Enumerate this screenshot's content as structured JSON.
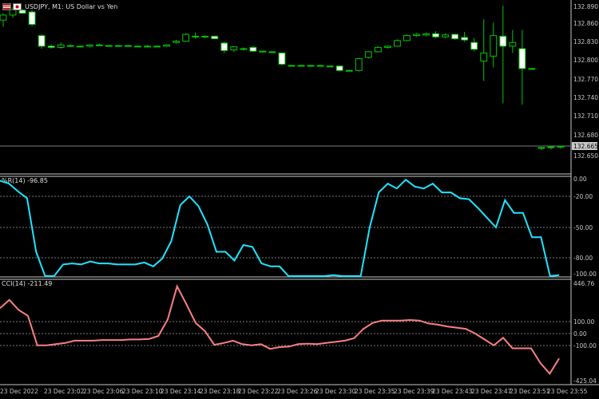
{
  "window": {
    "title": "USDJPY, M1:  US Dollar vs Yen"
  },
  "price_axis": {
    "labels": [
      "132.890",
      "132.860",
      "132.830",
      "132.800",
      "132.770",
      "132.740",
      "132.710",
      "132.680",
      "132.650"
    ],
    "current_price": "132.665"
  },
  "wpr": {
    "label": "%R(14) -96.85",
    "levels": [
      "0.00",
      "-20.00",
      "-50.00",
      "-80.00",
      "-100.00"
    ]
  },
  "cci": {
    "label": "CCI(14) -211.49",
    "levels": [
      "446.76",
      "100.00",
      "0.00",
      "-100.00",
      "-425.04"
    ]
  },
  "time_axis": {
    "labels": [
      "23 Dec 2022",
      "23 Dec 23:02",
      "23 Dec 23:06",
      "23 Dec 23:10",
      "23 Dec 23:14",
      "23 Dec 23:18",
      "23 Dec 23:22",
      "23 Dec 23:26",
      "23 Dec 23:30",
      "23 Dec 23:35",
      "23 Dec 23:39",
      "23 Dec 23:43",
      "23 Dec 23:47",
      "23 Dec 23:51",
      "23 Dec 23:55"
    ]
  },
  "colors": {
    "bull": "#00c800",
    "bear": "#ffffff",
    "wpr_line": "#1ee6ff",
    "cci_line": "#fa8080",
    "separator": "#c8c8c8",
    "grid": "#7a7a7a"
  },
  "chart_data": [
    {
      "type": "candlestick",
      "symbol": "USDJPY",
      "timeframe": "M1",
      "ylim": [
        132.64,
        132.9
      ],
      "candles": [
        {
          "o": 132.868,
          "h": 132.879,
          "l": 132.857,
          "c": 132.876
        },
        {
          "o": 132.876,
          "h": 132.889,
          "l": 132.872,
          "c": 132.885
        },
        {
          "o": 132.884,
          "h": 132.886,
          "l": 132.878,
          "c": 132.879
        },
        {
          "o": 132.881,
          "h": 132.884,
          "l": 132.858,
          "c": 132.861
        },
        {
          "o": 132.843,
          "h": 132.845,
          "l": 132.822,
          "c": 132.826
        },
        {
          "o": 132.826,
          "h": 132.829,
          "l": 132.822,
          "c": 132.824
        },
        {
          "o": 132.824,
          "h": 132.832,
          "l": 132.822,
          "c": 132.828
        },
        {
          "o": 132.827,
          "h": 132.829,
          "l": 132.825,
          "c": 132.826
        },
        {
          "o": 132.826,
          "h": 132.827,
          "l": 132.825,
          "c": 132.826
        },
        {
          "o": 132.826,
          "h": 132.829,
          "l": 132.824,
          "c": 132.828
        },
        {
          "o": 132.828,
          "h": 132.83,
          "l": 132.826,
          "c": 132.827
        },
        {
          "o": 132.827,
          "h": 132.828,
          "l": 132.826,
          "c": 132.827
        },
        {
          "o": 132.827,
          "h": 132.828,
          "l": 132.826,
          "c": 132.827
        },
        {
          "o": 132.827,
          "h": 132.828,
          "l": 132.826,
          "c": 132.826
        },
        {
          "o": 132.826,
          "h": 132.827,
          "l": 132.825,
          "c": 132.826
        },
        {
          "o": 132.826,
          "h": 132.828,
          "l": 132.824,
          "c": 132.826
        },
        {
          "o": 132.826,
          "h": 132.827,
          "l": 132.825,
          "c": 132.826
        },
        {
          "o": 132.826,
          "h": 132.829,
          "l": 132.825,
          "c": 132.828
        },
        {
          "o": 132.832,
          "h": 132.836,
          "l": 132.83,
          "c": 132.834
        },
        {
          "o": 132.834,
          "h": 132.847,
          "l": 132.833,
          "c": 132.845
        },
        {
          "o": 132.842,
          "h": 132.848,
          "l": 132.838,
          "c": 132.841
        },
        {
          "o": 132.841,
          "h": 132.843,
          "l": 132.839,
          "c": 132.842
        },
        {
          "o": 132.842,
          "h": 132.843,
          "l": 132.838,
          "c": 132.838
        },
        {
          "o": 132.831,
          "h": 132.833,
          "l": 132.815,
          "c": 132.819
        },
        {
          "o": 132.82,
          "h": 132.826,
          "l": 132.817,
          "c": 132.825
        },
        {
          "o": 132.822,
          "h": 132.824,
          "l": 132.819,
          "c": 132.821
        },
        {
          "o": 132.824,
          "h": 132.826,
          "l": 132.817,
          "c": 132.818
        },
        {
          "o": 132.818,
          "h": 132.819,
          "l": 132.816,
          "c": 132.817
        },
        {
          "o": 132.817,
          "h": 132.818,
          "l": 132.816,
          "c": 132.817
        },
        {
          "o": 132.815,
          "h": 132.816,
          "l": 132.795,
          "c": 132.797
        },
        {
          "o": 132.795,
          "h": 132.796,
          "l": 132.794,
          "c": 132.795
        },
        {
          "o": 132.795,
          "h": 132.796,
          "l": 132.794,
          "c": 132.795
        },
        {
          "o": 132.795,
          "h": 132.796,
          "l": 132.794,
          "c": 132.795
        },
        {
          "o": 132.795,
          "h": 132.796,
          "l": 132.794,
          "c": 132.795
        },
        {
          "o": 132.794,
          "h": 132.795,
          "l": 132.793,
          "c": 132.794
        },
        {
          "o": 132.794,
          "h": 132.795,
          "l": 132.785,
          "c": 132.787
        },
        {
          "o": 132.787,
          "h": 132.788,
          "l": 132.786,
          "c": 132.787
        },
        {
          "o": 132.787,
          "h": 132.807,
          "l": 132.785,
          "c": 132.806
        },
        {
          "o": 132.808,
          "h": 132.818,
          "l": 132.806,
          "c": 132.817
        },
        {
          "o": 132.817,
          "h": 132.826,
          "l": 132.816,
          "c": 132.824
        },
        {
          "o": 132.824,
          "h": 132.827,
          "l": 132.822,
          "c": 132.826
        },
        {
          "o": 132.826,
          "h": 132.837,
          "l": 132.825,
          "c": 132.835
        },
        {
          "o": 132.835,
          "h": 132.845,
          "l": 132.834,
          "c": 132.843
        },
        {
          "o": 132.843,
          "h": 132.847,
          "l": 132.841,
          "c": 132.845
        },
        {
          "o": 132.844,
          "h": 132.848,
          "l": 132.842,
          "c": 132.846
        },
        {
          "o": 132.846,
          "h": 132.85,
          "l": 132.839,
          "c": 132.841
        },
        {
          "o": 132.841,
          "h": 132.847,
          "l": 132.839,
          "c": 132.844
        },
        {
          "o": 132.845,
          "h": 132.846,
          "l": 132.836,
          "c": 132.838
        },
        {
          "o": 132.84,
          "h": 132.849,
          "l": 132.833,
          "c": 132.836
        },
        {
          "o": 132.832,
          "h": 132.839,
          "l": 132.818,
          "c": 132.821
        },
        {
          "o": 132.802,
          "h": 132.869,
          "l": 132.77,
          "c": 132.815
        },
        {
          "o": 132.81,
          "h": 132.864,
          "l": 132.792,
          "c": 132.843
        },
        {
          "o": 132.842,
          "h": 132.891,
          "l": 132.734,
          "c": 132.826
        },
        {
          "o": 132.826,
          "h": 132.852,
          "l": 132.815,
          "c": 132.832
        },
        {
          "o": 132.822,
          "h": 132.852,
          "l": 132.732,
          "c": 132.79
        },
        {
          "o": 132.79,
          "h": 132.791,
          "l": 132.789,
          "c": 132.79
        },
        {
          "o": 132.662,
          "h": 132.664,
          "l": 132.659,
          "c": 132.663
        },
        {
          "o": 132.663,
          "h": 132.665,
          "l": 132.66,
          "c": 132.664
        },
        {
          "o": 132.664,
          "h": 132.666,
          "l": 132.661,
          "c": 132.665
        }
      ]
    },
    {
      "type": "line",
      "indicator": "%R(14)",
      "ylim": [
        -100,
        0
      ],
      "levels": [
        0,
        -20,
        -50,
        -80,
        -100
      ],
      "values": [
        -2,
        -5,
        -13,
        -20,
        -75,
        -100,
        -100,
        -88,
        -87,
        -88,
        -85,
        -87,
        -87,
        -88,
        -88,
        -88,
        -86,
        -90,
        -82,
        -64,
        -27,
        -18,
        -28,
        -47,
        -75,
        -75,
        -84,
        -68,
        -70,
        -87,
        -90,
        -90,
        -100,
        -100,
        -100,
        -100,
        -100,
        -99,
        -100,
        -100,
        -100,
        -50,
        -14,
        -5,
        -10,
        -1,
        -8,
        -10,
        -5,
        -14,
        -14,
        -20,
        -21,
        -30,
        -40,
        -50,
        -22,
        -35,
        -35,
        -60,
        -60,
        -100,
        -99
      ]
    },
    {
      "type": "line",
      "indicator": "CCI(14)",
      "ylim": [
        -425.04,
        446.76
      ],
      "levels": [
        100,
        0,
        -100
      ],
      "values": [
        215,
        285,
        200,
        150,
        -100,
        -100,
        -90,
        -80,
        -60,
        -60,
        -60,
        -55,
        -55,
        -55,
        -50,
        -50,
        -45,
        -20,
        120,
        400,
        250,
        90,
        20,
        -95,
        -80,
        -60,
        -90,
        -100,
        -90,
        -130,
        -115,
        -110,
        -90,
        -85,
        -90,
        -80,
        -70,
        -60,
        -40,
        40,
        90,
        110,
        110,
        110,
        115,
        110,
        85,
        75,
        60,
        50,
        40,
        0,
        -50,
        -100,
        -35,
        -125,
        -125,
        -125,
        -250,
        -340,
        -211
      ]
    }
  ]
}
